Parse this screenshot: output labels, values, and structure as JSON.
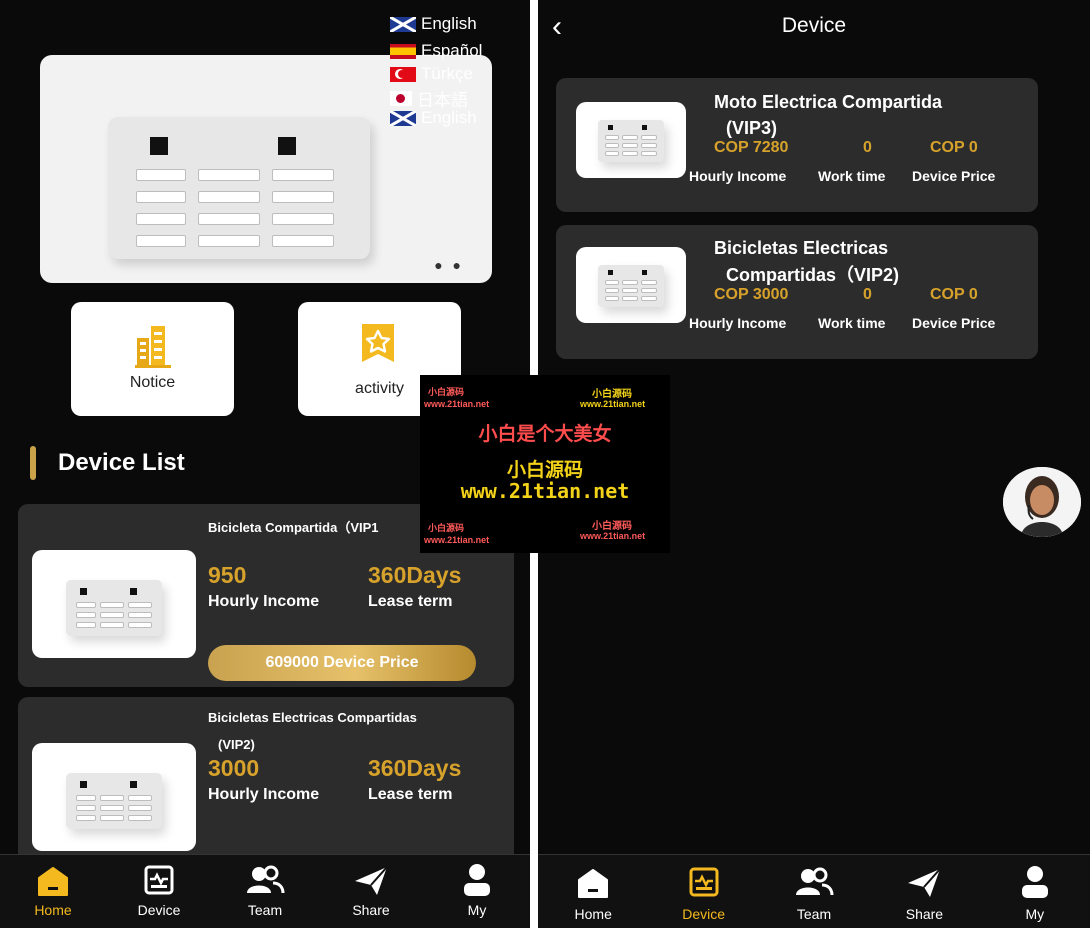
{
  "left": {
    "languages": [
      {
        "label": "English",
        "flag": "uk"
      },
      {
        "label": "Español",
        "flag": "es"
      },
      {
        "label": "Türkçe",
        "flag": "tr"
      },
      {
        "label": "日本語",
        "flag": "jp"
      },
      {
        "label": "English",
        "flag": "uk"
      }
    ],
    "shortcuts": [
      {
        "label": "Notice",
        "icon": "building-icon"
      },
      {
        "label": "activity",
        "icon": "star-badge-icon"
      }
    ],
    "section_title": "Device List",
    "devices": [
      {
        "name": "Bicicleta Compartida（VIP1",
        "hourly_income": "950",
        "hourly_income_label": "Hourly Income",
        "lease": "360Days",
        "lease_label": "Lease term",
        "price_button": "609000 Device Price"
      },
      {
        "name": "Bicicletas Electricas Compartidas",
        "name_line2": "(VIP2)",
        "hourly_income": "3000",
        "hourly_income_label": "Hourly Income",
        "lease": "360Days",
        "lease_label": "Lease term"
      }
    ],
    "nav": [
      {
        "label": "Home",
        "icon": "home-icon",
        "active": true
      },
      {
        "label": "Device",
        "icon": "device-icon",
        "active": false
      },
      {
        "label": "Team",
        "icon": "team-icon",
        "active": false
      },
      {
        "label": "Share",
        "icon": "share-icon",
        "active": false
      },
      {
        "label": "My",
        "icon": "user-icon",
        "active": false
      }
    ]
  },
  "right": {
    "back_icon": "chevron-left-icon",
    "title": "Device",
    "devices": [
      {
        "name_line1": "Moto Electrica Compartida",
        "name_line2": "(VIP3)",
        "hourly_income": "COP 7280",
        "work_time": "0",
        "device_price": "COP 0",
        "hourly_income_label": "Hourly Income",
        "work_time_label": "Work time",
        "device_price_label": "Device Price"
      },
      {
        "name_line1": "Bicicletas Electricas",
        "name_line2": "Compartidas（VIP2)",
        "hourly_income": "COP 3000",
        "work_time": "0",
        "device_price": "COP 0",
        "hourly_income_label": "Hourly Income",
        "work_time_label": "Work time",
        "device_price_label": "Device Price"
      }
    ],
    "nav": [
      {
        "label": "Home",
        "icon": "home-icon",
        "active": false
      },
      {
        "label": "Device",
        "icon": "device-icon",
        "active": true
      },
      {
        "label": "Team",
        "icon": "team-icon",
        "active": false
      },
      {
        "label": "Share",
        "icon": "share-icon",
        "active": false
      },
      {
        "label": "My",
        "icon": "user-icon",
        "active": false
      }
    ]
  },
  "watermark": {
    "main": "小白是个大美女",
    "brand": "小白源码",
    "url": "www.21tian.net",
    "small_brand": "小白源码",
    "small_url": "www.21tian.net"
  },
  "colors": {
    "accent": "#d7a22b",
    "background": "#0a0a0a",
    "card": "#2c2c2c"
  }
}
